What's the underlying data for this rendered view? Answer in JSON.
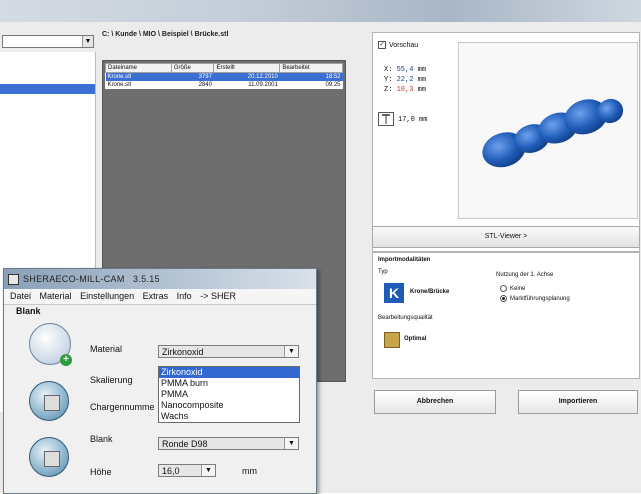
{
  "background_window": {
    "path": "C: \\ Kunde \\ MIO \\ Beispiel \\ Brücke.stl",
    "file_list": {
      "columns": [
        "Dateiname",
        "Größe",
        "Erstellt",
        "Bearbeitet"
      ],
      "rows": [
        {
          "name": "Krone.stl",
          "size": "3797",
          "date": "20.12.2010",
          "time": "18:52",
          "selected": true
        },
        {
          "name": "Krone.stl",
          "size": "2840",
          "date": "11.09.2001",
          "time": "09:25",
          "selected": false
        }
      ]
    },
    "preview": {
      "checkbox_label": "Vorschau",
      "checked": true,
      "x": {
        "axis": "X:",
        "value": "55,4",
        "unit": "mm"
      },
      "y": {
        "axis": "Y:",
        "value": "22,2",
        "unit": "mm"
      },
      "z": {
        "axis": "Z:",
        "value": "10,3",
        "unit": "mm"
      },
      "height_value": "17,0",
      "height_unit": "mm"
    },
    "stl_viewer_button": "STL-Viewer >",
    "import": {
      "heading": "Importmodalitäten",
      "type_label": "Typ",
      "type_value": "Krone/Brücke",
      "quality_label": "Bearbeitungsqualität",
      "quality_value": "Optimal",
      "alignment_label": "Nutzung der 1. Achse",
      "options": [
        {
          "label": "Keine",
          "selected": false
        },
        {
          "label": "Marktführungsplanung",
          "selected": true
        }
      ]
    },
    "cancel_button": "Abbrechen",
    "import_button": "Importieren"
  },
  "foreground_window": {
    "title": "SHERAECO-MILL-CAM",
    "version": "3.5.15",
    "menu": [
      "Datei",
      "Material",
      "Einstellungen",
      "Extras",
      "Info",
      "-> SHER"
    ],
    "section": "Blank",
    "material_label": "Material",
    "material_value": "Zirkonoxid",
    "material_options": [
      "Zirkonoxid",
      "PMMA burn",
      "PMMA",
      "Nanocomposite",
      "Wachs"
    ],
    "scaling_label": "Skalierung",
    "batch_label": "Chargennumme",
    "blank_label": "Blank",
    "blank_value": "Ronde D98",
    "height_label": "Höhe",
    "height_value": "16,0",
    "height_unit": "mm"
  },
  "colors": {
    "selection": "#3368d2",
    "model_blue": "#1f5cb8",
    "z_value_red": "#c0392b"
  }
}
